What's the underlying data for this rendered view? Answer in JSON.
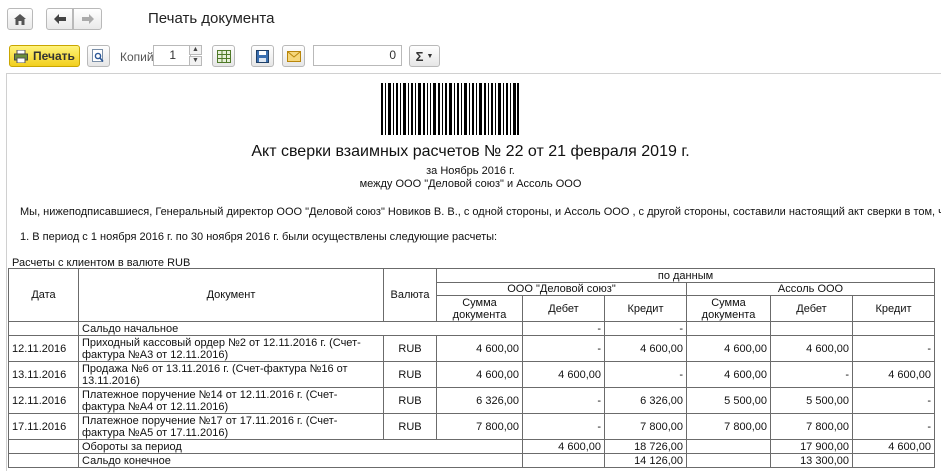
{
  "window": {
    "title": "Печать документа"
  },
  "nav": {
    "home_icon": "home-icon",
    "back_icon": "arrow-left-icon",
    "forward_icon": "arrow-right-icon"
  },
  "toolbar": {
    "print_label": "Печать",
    "copies_label": "Копий:",
    "copies_value": "1",
    "sum_value": "0",
    "sum_label": "Σ",
    "accent_color": "#f2cf1e"
  },
  "document": {
    "title": "Акт сверки взаимных расчетов № 22 от 21 февраля 2019 г.",
    "period": "за Ноябрь 2016 г.",
    "between": "между ООО \"Деловой союз\" и Ассоль ООО",
    "intro": "Мы, нижеподписавшиеся, Генеральный директор ООО \"Деловой союз\" Новиков В. В., с одной стороны, и  Ассоль ООО , с другой стороны, составили настоящий акт сверки в том, что:",
    "point1": "1. В период с 1 ноября 2016 г. по 30 ноября 2016 г. были осуществлены следующие расчеты:",
    "caption": "Расчеты с клиентом в валюте RUB"
  },
  "table": {
    "headers": {
      "date": "Дата",
      "document": "Документ",
      "currency": "Валюта",
      "by_data": "по данным",
      "party1": "ООО \"Деловой союз\"",
      "party2": "Ассоль ООО",
      "sum_doc": "Сумма документа",
      "debit": "Дебет",
      "credit": "Кредит"
    },
    "opening": {
      "label": "Сальдо начальное",
      "dash1": "-",
      "dash2": "-"
    },
    "rows": [
      {
        "date": "12.11.2016",
        "doc": "Приходный кассовый ордер №2 от 12.11.2016 г. (Счет-фактура №А3 от 12.11.2016)",
        "cur": "RUB",
        "s1": "4 600,00",
        "d1": "-",
        "c1": "4 600,00",
        "s2": "4 600,00",
        "d2": "4 600,00",
        "c2": "-"
      },
      {
        "date": "13.11.2016",
        "doc": "Продажа №6 от 13.11.2016 г. (Счет-фактура №16 от 13.11.2016)",
        "cur": "RUB",
        "s1": "4 600,00",
        "d1": "4 600,00",
        "c1": "-",
        "s2": "4 600,00",
        "d2": "-",
        "c2": "4 600,00"
      },
      {
        "date": "12.11.2016",
        "doc": "Платежное поручение №14 от 12.11.2016 г. (Счет-фактура №А4 от 12.11.2016)",
        "cur": "RUB",
        "s1": "6 326,00",
        "d1": "-",
        "c1": "6 326,00",
        "s2": "5 500,00",
        "d2": "5 500,00",
        "c2": "-"
      },
      {
        "date": "17.11.2016",
        "doc": "Платежное поручение №17 от 17.11.2016 г. (Счет-фактура №А5 от 17.11.2016)",
        "cur": "RUB",
        "s1": "7 800,00",
        "d1": "-",
        "c1": "7 800,00",
        "s2": "7 800,00",
        "d2": "7 800,00",
        "c2": "-"
      }
    ],
    "turnover": {
      "label": "Обороты за период",
      "d1": "4 600,00",
      "c1": "18 726,00",
      "d2": "17 900,00",
      "c2": "4 600,00"
    },
    "closing": {
      "label": "Сальдо конечное",
      "c1": "14 126,00",
      "d2": "13 300,00"
    }
  }
}
